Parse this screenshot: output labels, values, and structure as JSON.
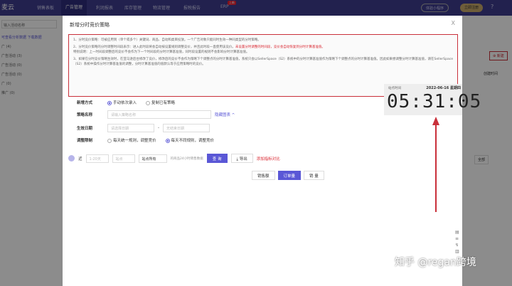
{
  "topbar": {
    "logo": "麦云",
    "nav": [
      "销售表板",
      "广告管理",
      "利润报表",
      "库存管理",
      "物流管理",
      "报税报告",
      "ERP"
    ],
    "active": 1,
    "erp_badge": "上新",
    "mini_program": "体验小程序",
    "register": "立即注册"
  },
  "sidebar": {
    "search_placeholder": "输入活动名称",
    "hint": "可查看分析数据 下载数据",
    "items": [
      "广 (4)",
      "广告活动 (3)",
      "广告活动 (0)",
      "广告活动 (0)",
      "广 (0)",
      "推广 (0)"
    ]
  },
  "modal": {
    "title": "新增分时竞价策略",
    "close": "X",
    "notice": {
      "p1": "1、分时竞价策略：可被应用到（单个或多个）关键词、商品、自动和类目投放。一个广告对象只能同时生效一种同类型的分时策略。",
      "p2a": "2、分时竞价策略的分时调整时间段表示：进入此时段将会自动按设置规则调整竞价，并且此时段一直使用该竞价。",
      "p2b": "未设置分时调整的时间段，竞价会自动恢复到分时计算基准值。",
      "p2c": "特别说明：上一时间段调整后的竞价不会作为下一个时间段的分时计算基准值，同时段设置的规则不会影响分时计算基准值。",
      "p3": "3、如果在分时竞价策略生效时，在亚马逊后台修改了竞价，修改后的竞价不会作为策略下个调整点的分时计算基准值，系统只会以SellerSpace（S2）系统中的分时计算基准值作为策略下个调整点的分时计算基准值。因此如果想调整分时计算基准值，请在SellerSpace（S2）系统中操作分时计算基准值的调整，分时计算基准值的值默认等于应用策略时的竞价。"
    },
    "form": {
      "mode_label": "新增方式",
      "mode_options": [
        "手动依次录入",
        "复制已有策略"
      ],
      "name_label": "策略名称",
      "name_placeholder": "请输入策略名称",
      "hide_chart": "隐藏图表 ^",
      "date_label": "生效日期",
      "start_placeholder": "请选择日期",
      "end_placeholder": "无结束日期",
      "adjust_label": "调整限制",
      "adjust_options": [
        "每天统一规则，调整竞价",
        "每天不同规则，调整竞价"
      ]
    },
    "filter": {
      "near": "近",
      "days": "1-20天",
      "site": "站点",
      "timezone": "站点所有",
      "desc": "的商品24小时销售数据",
      "query": "查 询",
      "export": "导出",
      "add": "添加指标对比"
    },
    "tabs": [
      "销售额",
      "订单量",
      "销 量"
    ],
    "active_tab": 1,
    "clock": {
      "label": "站点时间",
      "date": "2022-06-16 星期四",
      "time": "05:31:05"
    }
  },
  "background": {
    "right_btn": "⊕ 新建",
    "created": "创建时间",
    "filter": "全部"
  },
  "watermark": "知乎 @regan跨境",
  "colors": {
    "nav": "#3f3c8f",
    "primary": "#5a57d6",
    "notice_border": "#c9303a",
    "arrow": "#c9303a"
  }
}
